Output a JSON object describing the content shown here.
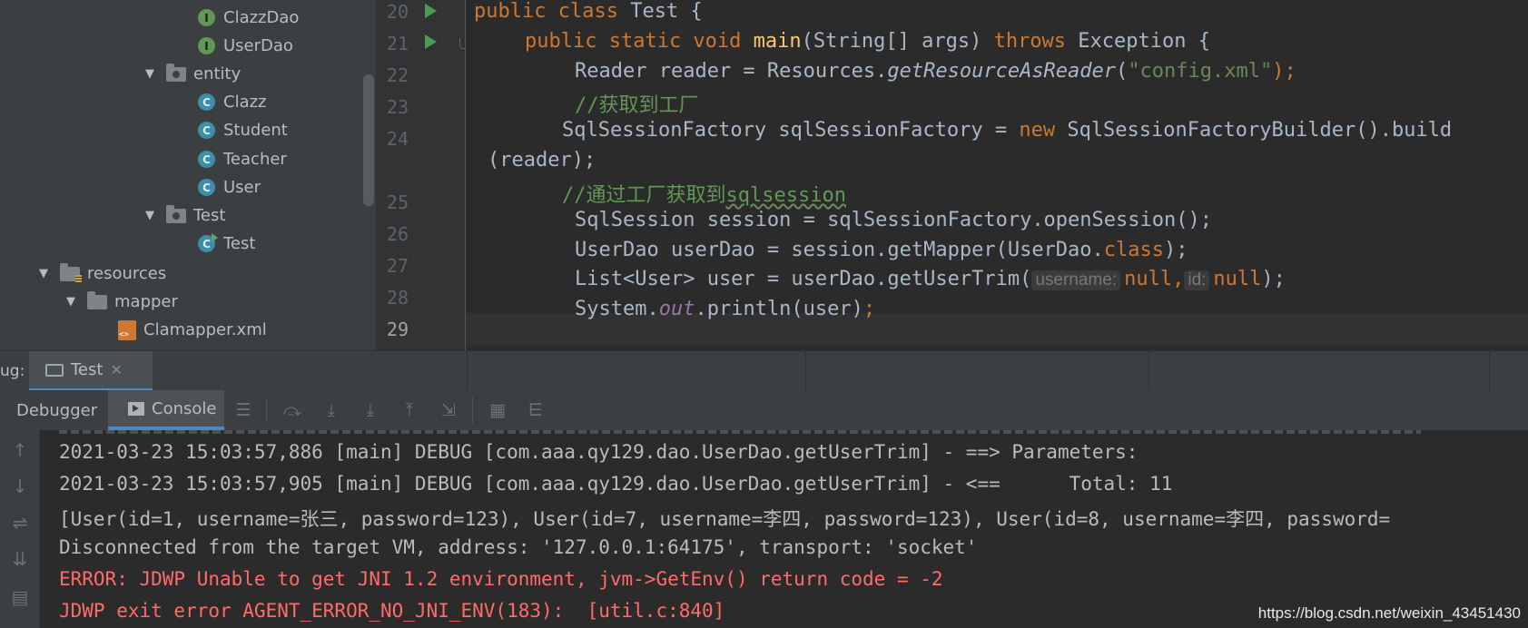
{
  "tree": {
    "items": [
      {
        "label": "ClazzDao",
        "icon": "interface-icon"
      },
      {
        "label": "UserDao",
        "icon": "interface-icon"
      },
      {
        "label": "entity",
        "icon": "package-folder-icon"
      },
      {
        "label": "Clazz",
        "icon": "class-icon"
      },
      {
        "label": "Student",
        "icon": "class-icon"
      },
      {
        "label": "Teacher",
        "icon": "class-icon"
      },
      {
        "label": "User",
        "icon": "class-icon"
      },
      {
        "label": "Test",
        "icon": "package-folder-icon"
      },
      {
        "label": "Test",
        "icon": "runnable-class-icon"
      },
      {
        "label": "resources",
        "icon": "resources-folder-icon"
      },
      {
        "label": "mapper",
        "icon": "folder-icon"
      },
      {
        "label": "Clamapper.xml",
        "icon": "xml-file-icon"
      }
    ]
  },
  "editor": {
    "line_numbers": [
      "20",
      "21",
      "22",
      "23",
      "24",
      "25",
      "26",
      "27",
      "28",
      "29"
    ],
    "code": {
      "l20_kw": "public class",
      "l20_rest": " Test {",
      "l21_kw1": "public static void",
      "l21_fn": "main",
      "l21_mid": "(String[] args) ",
      "l21_kw2": "throws",
      "l21_end": " Exception {",
      "l22_a": "Reader reader = Resources.",
      "l22_fn": "getResourceAsReader",
      "l22_p": "(",
      "l22_str": "\"config.xml\"",
      "l22_end": ");",
      "l23_cmt": "//获取到工厂",
      "l24_a": "SqlSessionFactory sqlSessionFactory = ",
      "l24_kw": "new",
      "l24_b": " SqlSessionFactoryBuilder().build",
      "l24_wrap": "(reader);",
      "l25_cmt": "//通过工厂获取到",
      "l25_sq": "sqlsession",
      "l26": "SqlSession session = sqlSessionFactory.openSession();",
      "l27_a": "UserDao userDao = session.getMapper(UserDao.",
      "l27_kw": "class",
      "l27_end": ");",
      "l28_a": "List<User> user = userDao.getUserTrim(",
      "l28_hint1": "username:",
      "l28_null1": "null,",
      "l28_hint2": "id:",
      "l28_null2": "null",
      "l28_end": ");",
      "l29_a": "System.",
      "l29_fld": "out",
      "l29_b": ".println(user)",
      "l29_end": ";"
    }
  },
  "debug": {
    "label": "ug:",
    "tab_label": "Test",
    "tab_close": "✕",
    "debugger_tab": "Debugger",
    "console_tab": "Console"
  },
  "console": {
    "lines": [
      "2021-03-23 15:03:57,886 [main] DEBUG [com.aaa.qy129.dao.UserDao.getUserTrim] - ==> Parameters: ",
      "2021-03-23 15:03:57,905 [main] DEBUG [com.aaa.qy129.dao.UserDao.getUserTrim] - <==      Total: 11",
      "[User(id=1, username=张三, password=123), User(id=7, username=李四, password=123), User(id=8, username=李四, password=",
      "Disconnected from the target VM, address: '127.0.0.1:64175', transport: 'socket'",
      "ERROR: JDWP Unable to get JNI 1.2 environment, jvm->GetEnv() return code = -2",
      "JDWP exit error AGENT_ERROR_NO_JNI_ENV(183):  [util.c:840]"
    ]
  },
  "watermark": "https://blog.csdn.net/weixin_43451430",
  "colors": {
    "keyword": "#cc7832",
    "function": "#ffc66d",
    "string": "#6a8759",
    "comment": "#629755",
    "error": "#ff6b68",
    "accent": "#4a88c7"
  }
}
